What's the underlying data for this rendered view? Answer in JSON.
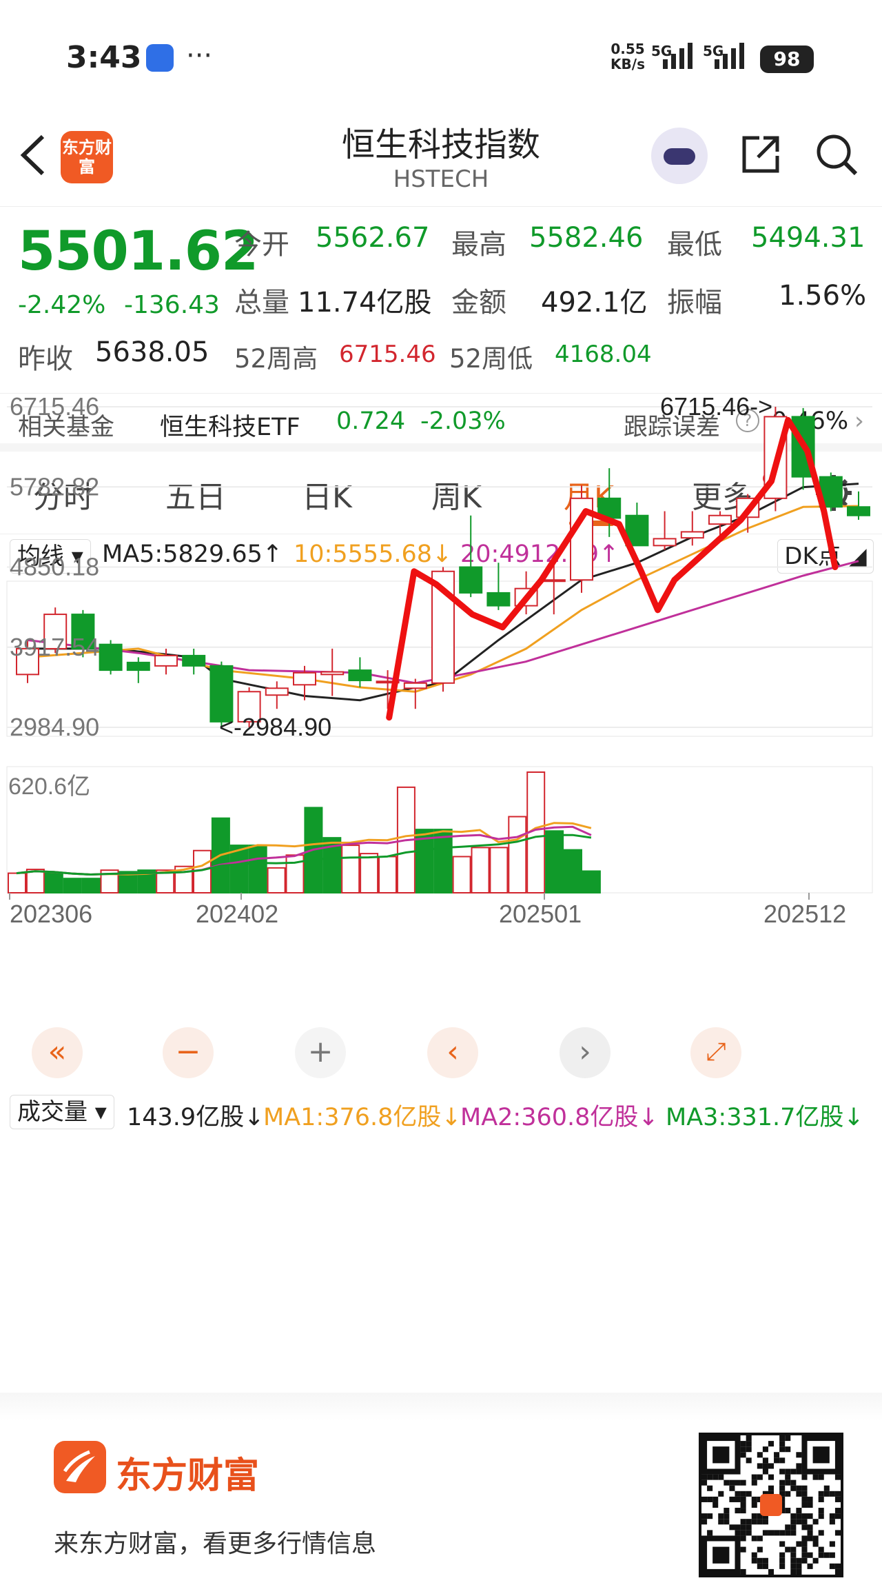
{
  "status": {
    "time": "3:43",
    "dots": "···",
    "net_speed": "0.55",
    "net_unit": "KB/s",
    "sig1": "5G",
    "sig2": "5G",
    "battery": "98"
  },
  "header": {
    "back_icon": "chevron-left-icon",
    "logo_text": "东方财富",
    "title": "恒生科技指数",
    "subtitle": "HSTECH"
  },
  "quote": {
    "price": "5501.62",
    "change_pct": "-2.42%",
    "change_abs": "-136.43",
    "open_label": "今开",
    "open": "5562.67",
    "high_label": "最高",
    "high": "5582.46",
    "low_label": "最低",
    "low": "5494.31",
    "volume_label": "总量",
    "volume": "11.74亿股",
    "amount_label": "金额",
    "amount": "492.1亿",
    "amplitude_label": "振幅",
    "amplitude": "1.56%",
    "prev_close_label": "昨收",
    "prev_close": "5638.05",
    "wk52_high_label": "52周高",
    "wk52_high": "6715.46",
    "wk52_low_label": "52周低",
    "wk52_low": "4168.04"
  },
  "fund": {
    "label": "相关基金",
    "name": "恒生科技ETF",
    "price": "0.724",
    "change": "-2.03%",
    "tracking_label": "跟踪误差",
    "tracking_value": "0.46%",
    "chevron": "›"
  },
  "tabs": [
    {
      "label": "分时"
    },
    {
      "label": "五日"
    },
    {
      "label": "日K"
    },
    {
      "label": "周K"
    },
    {
      "label": "月K",
      "active": true
    },
    {
      "label": "更多"
    }
  ],
  "ma_bar": {
    "selector": "均线",
    "ma5": "MA5:5829.65↑",
    "ma10": "10:5555.68↓",
    "ma20": "20:4912.19↑",
    "dk": "DK点"
  },
  "vol_bar": {
    "selector": "成交量",
    "volume": "143.9亿股↓",
    "ma1": "MA1:376.8亿股↓",
    "ma2": "MA2:360.8亿股↓",
    "ma3": "MA3:331.7亿股↓"
  },
  "colors": {
    "up": "#d2262e",
    "down": "#109a2a",
    "ma5": "#222222",
    "ma10": "#f0a020",
    "ma20": "#c0309a",
    "accent": "#e8641b",
    "annotation": "#ee1111"
  },
  "chart_data": {
    "type": "candlestick",
    "title": "",
    "y_ticks": [
      "6715.46",
      "5782.82",
      "4850.18",
      "3917.54",
      "2984.90"
    ],
    "ylim": [
      2984.9,
      6715.46
    ],
    "x_ticks": [
      "202306",
      "202402",
      "202501",
      "202512"
    ],
    "annotations": [
      "6715.46->",
      "<-2984.90"
    ],
    "candles": [
      {
        "o": 3600,
        "h": 4000,
        "l": 3500,
        "c": 3900
      },
      {
        "o": 3900,
        "h": 4380,
        "l": 3850,
        "c": 4300
      },
      {
        "o": 4300,
        "h": 4350,
        "l": 3800,
        "c": 3900
      },
      {
        "o": 3950,
        "h": 4000,
        "l": 3600,
        "c": 3650
      },
      {
        "o": 3740,
        "h": 3800,
        "l": 3500,
        "c": 3650
      },
      {
        "o": 3700,
        "h": 3900,
        "l": 3600,
        "c": 3820
      },
      {
        "o": 3820,
        "h": 3900,
        "l": 3600,
        "c": 3700
      },
      {
        "o": 3700,
        "h": 3750,
        "l": 2984.9,
        "c": 3050
      },
      {
        "o": 3050,
        "h": 3450,
        "l": 2984.9,
        "c": 3400
      },
      {
        "o": 3360,
        "h": 3520,
        "l": 3200,
        "c": 3440
      },
      {
        "o": 3480,
        "h": 3700,
        "l": 3300,
        "c": 3620
      },
      {
        "o": 3600,
        "h": 3900,
        "l": 3350,
        "c": 3630
      },
      {
        "o": 3650,
        "h": 3800,
        "l": 3450,
        "c": 3530
      },
      {
        "o": 3520,
        "h": 3650,
        "l": 3200,
        "c": 3520
      },
      {
        "o": 3440,
        "h": 3550,
        "l": 3200,
        "c": 3500
      },
      {
        "o": 3500,
        "h": 4850,
        "l": 3400,
        "c": 4800
      },
      {
        "o": 4850,
        "h": 5450,
        "l": 4500,
        "c": 4550
      },
      {
        "o": 4550,
        "h": 4900,
        "l": 4350,
        "c": 4400
      },
      {
        "o": 4400,
        "h": 4800,
        "l": 4300,
        "c": 4600
      },
      {
        "o": 4700,
        "h": 4900,
        "l": 4300,
        "c": 4700
      },
      {
        "o": 4700,
        "h": 5800,
        "l": 4550,
        "c": 5650
      },
      {
        "o": 5650,
        "h": 6000,
        "l": 5200,
        "c": 5420
      },
      {
        "o": 5450,
        "h": 5600,
        "l": 5100,
        "c": 5100
      },
      {
        "o": 5100,
        "h": 5500,
        "l": 5050,
        "c": 5180
      },
      {
        "o": 5190,
        "h": 5500,
        "l": 5100,
        "c": 5260
      },
      {
        "o": 5350,
        "h": 5500,
        "l": 5150,
        "c": 5450
      },
      {
        "o": 5430,
        "h": 5700,
        "l": 5250,
        "c": 5650
      },
      {
        "o": 5650,
        "h": 6715.46,
        "l": 5500,
        "c": 6600
      },
      {
        "o": 6600,
        "h": 6700,
        "l": 5750,
        "c": 5900
      },
      {
        "o": 5900,
        "h": 5950,
        "l": 5500,
        "c": 5550
      },
      {
        "o": 5550,
        "h": 5730,
        "l": 5400,
        "c": 5450
      }
    ],
    "ma_series": [
      {
        "name": "MA5",
        "points": [
          [
            0,
            3900
          ],
          [
            3,
            3900
          ],
          [
            6,
            3800
          ],
          [
            7,
            3550
          ],
          [
            10,
            3350
          ],
          [
            12,
            3300
          ],
          [
            14,
            3450
          ],
          [
            15,
            3500
          ],
          [
            17,
            4000
          ],
          [
            20,
            4700
          ],
          [
            22,
            4900
          ],
          [
            24,
            5200
          ],
          [
            26,
            5450
          ],
          [
            28,
            5780
          ],
          [
            30,
            5820
          ]
        ]
      },
      {
        "name": "10",
        "points": [
          [
            0,
            3800
          ],
          [
            4,
            3900
          ],
          [
            7,
            3650
          ],
          [
            10,
            3550
          ],
          [
            12,
            3450
          ],
          [
            14,
            3400
          ],
          [
            16,
            3600
          ],
          [
            18,
            3900
          ],
          [
            20,
            4350
          ],
          [
            22,
            4700
          ],
          [
            24,
            5000
          ],
          [
            26,
            5300
          ],
          [
            28,
            5550
          ],
          [
            30,
            5560
          ]
        ]
      },
      {
        "name": "20",
        "points": [
          [
            0,
            4000
          ],
          [
            4,
            3850
          ],
          [
            8,
            3650
          ],
          [
            12,
            3620
          ],
          [
            14,
            3500
          ],
          [
            16,
            3620
          ],
          [
            18,
            3750
          ],
          [
            20,
            3950
          ],
          [
            22,
            4150
          ],
          [
            24,
            4350
          ],
          [
            26,
            4550
          ],
          [
            28,
            4750
          ],
          [
            30,
            4920
          ]
        ]
      }
    ],
    "volume": {
      "ymax": "620.6亿",
      "values": [
        130,
        155,
        130,
        95,
        95,
        150,
        140,
        150,
        150,
        175,
        280,
        495,
        315,
        315,
        165,
        250,
        565,
        365,
        315,
        260,
        240,
        700,
        420,
        420,
        240,
        300,
        300,
        505,
        800,
        410,
        285,
        143.9
      ],
      "up": [
        1,
        1,
        0,
        0,
        0,
        1,
        0,
        0,
        1,
        1,
        1,
        0,
        0,
        0,
        1,
        1,
        0,
        0,
        1,
        1,
        1,
        1,
        0,
        0,
        1,
        1,
        1,
        1,
        1,
        0,
        0,
        0
      ]
    }
  },
  "footer": {
    "brand": "东方财富",
    "slogan": "来东方财富，看更多行情信息"
  }
}
